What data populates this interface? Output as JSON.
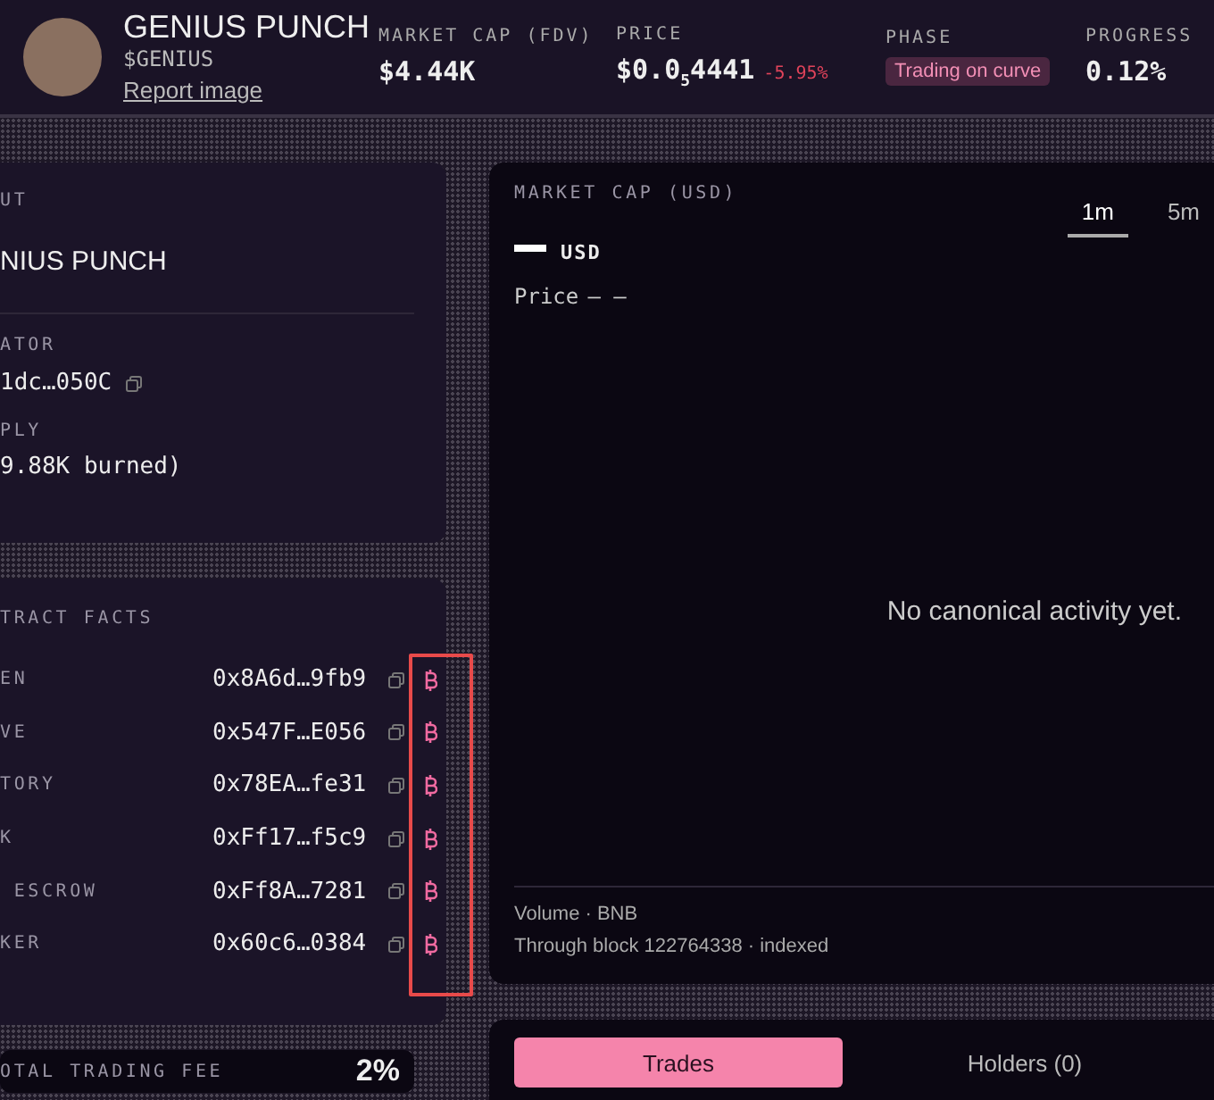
{
  "header": {
    "name": "GENIUS PUNCH",
    "ticker": "$GENIUS",
    "report_link": "Report image",
    "stats": [
      {
        "kind": "plain",
        "label": "MARKET CAP (FDV)",
        "value": "$4.44K"
      },
      {
        "kind": "price",
        "label": "PRICE",
        "lead": "$0.0",
        "zeros": "5",
        "tail": "4441",
        "change": "-5.95%"
      },
      {
        "kind": "badge",
        "label": "PHASE",
        "value": "Trading on curve"
      },
      {
        "kind": "plain",
        "label": "PROGRESS",
        "value": "0.12%"
      }
    ]
  },
  "about": {
    "heading": "UT",
    "name": "NIUS PUNCH",
    "creator_label": "ATOR",
    "creator": "1dc…050C",
    "supply_label": "PLY",
    "supply": "9.88K burned)"
  },
  "contract_facts": {
    "heading": "TRACT FACTS",
    "rows": [
      {
        "label": "EN",
        "address": "0x8A6d…9fb9"
      },
      {
        "label": "VE",
        "address": "0x547F…E056"
      },
      {
        "label": "TORY",
        "address": "0x78EA…fe31"
      },
      {
        "label": "K",
        "address": "0xFf17…f5c9"
      },
      {
        "label": " ESCROW",
        "address": "0xFf8A…7281"
      },
      {
        "label": "KER",
        "address": "0x60c6…0384"
      }
    ]
  },
  "fee": {
    "label": "OTAL TRADING FEE",
    "value": "2%"
  },
  "chart": {
    "title": "MARKET CAP (USD)",
    "legend": "USD",
    "price_label": "Price",
    "price_value": "— —",
    "empty": "No canonical activity yet.",
    "intervals": [
      {
        "label": "1m",
        "selected": true
      },
      {
        "label": "5m",
        "selected": false
      }
    ],
    "volume": "Volume · BNB",
    "through": "Through block 122764338 · indexed"
  },
  "tabs": [
    {
      "label": "Trades",
      "selected": true
    },
    {
      "label": "Holders (0)",
      "selected": false
    }
  ]
}
